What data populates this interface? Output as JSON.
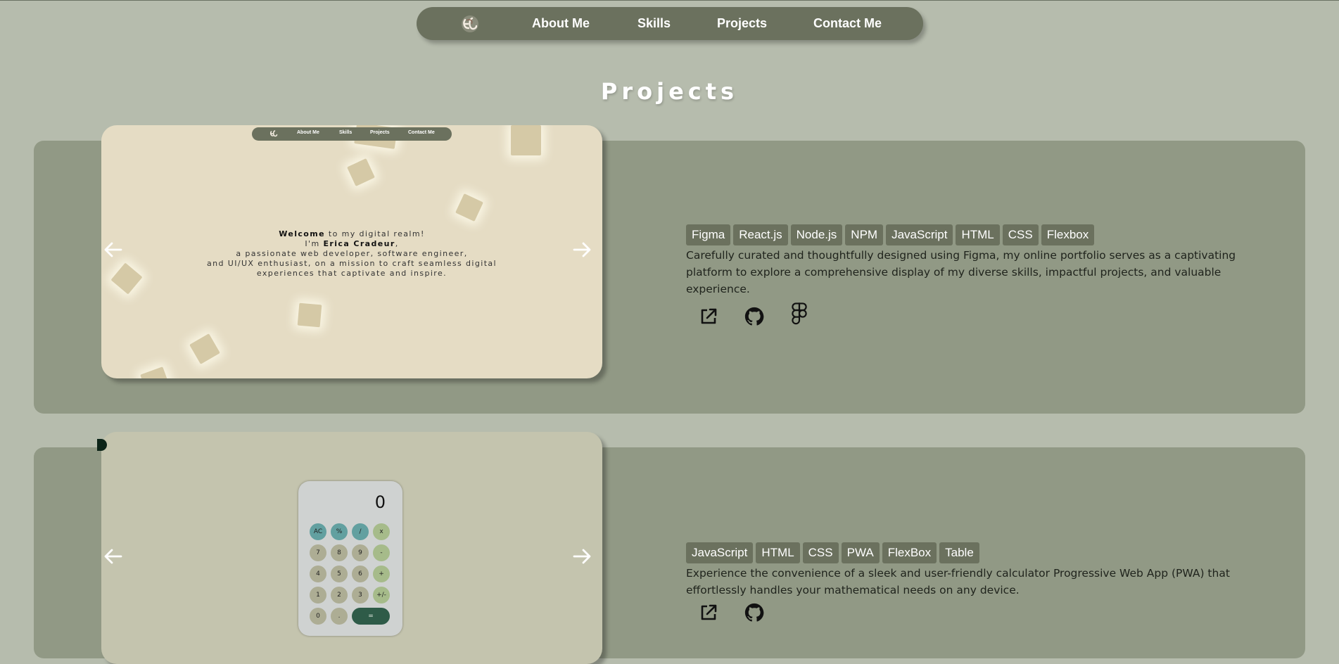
{
  "nav": {
    "logo_icon": "ec-monogram-logo",
    "links": [
      "About Me",
      "Skills",
      "Projects",
      "Contact Me"
    ]
  },
  "page_title": "Projects",
  "colors": {
    "background": "#b6bcad",
    "nav": "#6b715e",
    "card": "#919985",
    "tag": "#6b715e"
  },
  "projects": [
    {
      "preview": {
        "nav_links": [
          "About Me",
          "Skills",
          "Projects",
          "Contact Me"
        ],
        "welcome_bold": "Welcome",
        "welcome_rest": " to my digital realm!",
        "im": "I'm ",
        "name": "Erica Cradeur",
        "name_suffix": ",",
        "line3": "a passionate web developer, software engineer,",
        "line4": "and UI/UX enthusiast, on a mission to craft seamless digital",
        "line5": "experiences that captivate and inspire."
      },
      "tags": [
        "Figma",
        "React.js",
        "Node.js",
        "NPM",
        "JavaScript",
        "HTML",
        "CSS",
        "Flexbox"
      ],
      "description": "Carefully curated and thoughtfully designed using Figma, my online portfolio serves as a captivating platform to explore a comprehensive display of my diverse skills, impactful projects, and valuable experience.",
      "links": [
        "external-link-icon",
        "github-icon",
        "figma-icon"
      ]
    },
    {
      "preview": {
        "display": "0",
        "buttons": [
          "AC",
          "%",
          "/",
          "x",
          "7",
          "8",
          "9",
          "-",
          "4",
          "5",
          "6",
          "+",
          "1",
          "2",
          "3",
          "+/-",
          "0",
          ".",
          "="
        ]
      },
      "tags": [
        "JavaScript",
        "HTML",
        "CSS",
        "PWA",
        "FlexBox",
        "Table"
      ],
      "description": "Experience the convenience of a sleek and user-friendly calculator Progressive Web App (PWA) that effortlessly handles your mathematical needs on any device.",
      "links": [
        "external-link-icon",
        "github-icon"
      ]
    }
  ]
}
